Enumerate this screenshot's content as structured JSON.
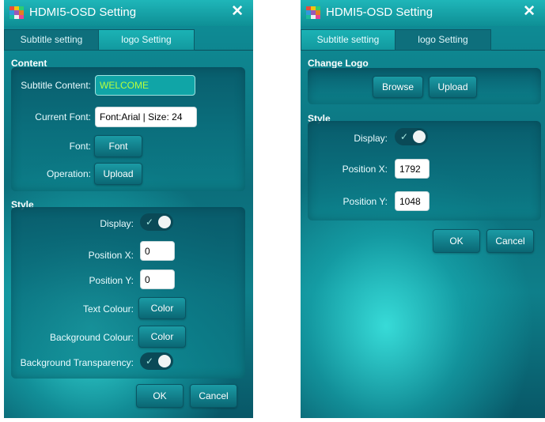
{
  "left_window": {
    "title": "HDMI5-OSD Setting",
    "close_glyph": "✕",
    "tabs": [
      {
        "label": "Subtitle setting",
        "state": "selected"
      },
      {
        "label": "logo Setting",
        "state": "unselected"
      }
    ],
    "content": {
      "heading": "Content",
      "subtitle_content_label": "Subtitle Content:",
      "subtitle_content_value": "WELCOME",
      "current_font_label": "Current Font:",
      "current_font_value": "Font:Arial | Size: 24",
      "font_label": "Font:",
      "font_button": "Font",
      "operation_label": "Operation:",
      "operation_button": "Upload"
    },
    "style": {
      "heading": "Style",
      "display_label": "Display:",
      "display_on": true,
      "position_x_label": "Position X:",
      "position_x_value": "0",
      "position_y_label": "Position Y:",
      "position_y_value": "0",
      "text_colour_label": "Text Colour:",
      "text_colour_button": "Color",
      "background_colour_label": "Background Colour:",
      "background_colour_button": "Color",
      "background_transparency_label": "Background Transparency:",
      "background_transparency_on": true
    },
    "ok_button": "OK",
    "cancel_button": "Cancel"
  },
  "right_window": {
    "title": "HDMI5-OSD Setting",
    "close_glyph": "✕",
    "tabs": [
      {
        "label": "Subtitle setting",
        "state": "unselected"
      },
      {
        "label": "logo Setting",
        "state": "selected"
      }
    ],
    "change_logo": {
      "heading": "Change Logo",
      "browse_button": "Browse",
      "upload_button": "Upload"
    },
    "style": {
      "heading": "Style",
      "display_label": "Display:",
      "display_on": true,
      "position_x_label": "Position X:",
      "position_x_value": "1792",
      "position_y_label": "Position Y:",
      "position_y_value": "1048"
    },
    "ok_button": "OK",
    "cancel_button": "Cancel"
  },
  "icons": {
    "app_icon": "multicolor-grid-icon",
    "close_icon": "close-icon",
    "toggle_check": "check-icon"
  },
  "colors": {
    "window_teal": "#0e7f8a",
    "titlebar": "#1fb6b9",
    "welcome_text": "#b7ff3c",
    "toggle_track": "#0a4a57"
  }
}
